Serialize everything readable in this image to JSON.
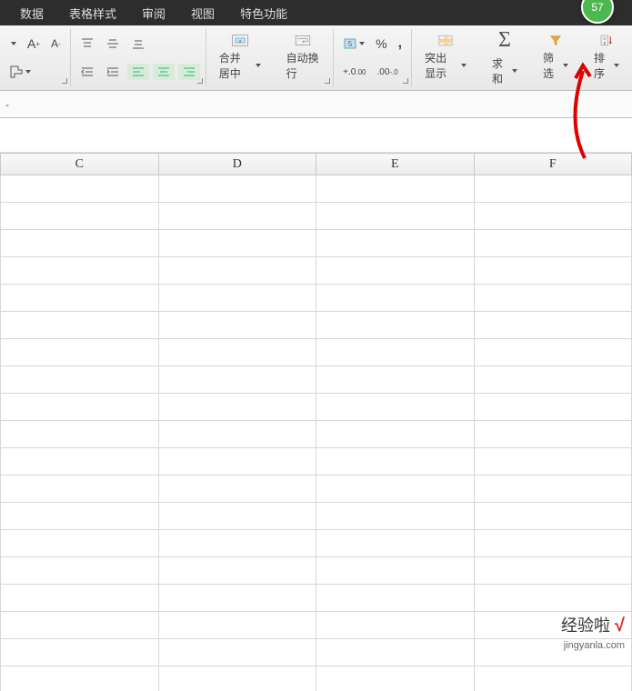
{
  "menu": {
    "items": [
      "数据",
      "表格样式",
      "审阅",
      "视图",
      "特色功能"
    ],
    "badge": "57"
  },
  "ribbon": {
    "merge_label": "合并居中",
    "wrap_label": "自动换行",
    "highlight_label": "突出显示",
    "sum_label": "求和",
    "filter_label": "筛选",
    "sort_label": "排序",
    "percent": "%",
    "thousand": ",",
    "increase_decimal": ".0",
    "decrease_decimal": ".00"
  },
  "formula_bar": {
    "indicator": "-"
  },
  "columns": [
    "C",
    "D",
    "E",
    "F"
  ],
  "rows_count": 19,
  "watermark": {
    "brand": "经验啦",
    "check": "√",
    "url": "jingyanla.com"
  }
}
